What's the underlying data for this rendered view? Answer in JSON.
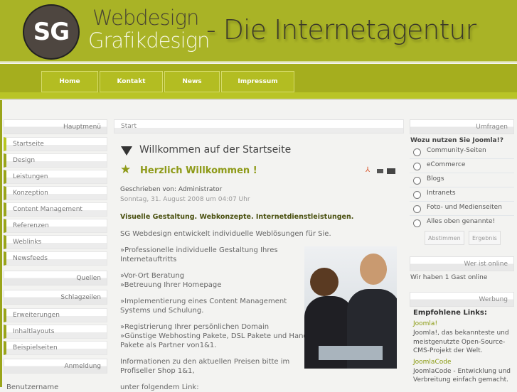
{
  "header": {
    "logo": "SG",
    "line1": "Webdesign",
    "line2": "Grafikdesign",
    "tagline": "- Die Internetagentur"
  },
  "nav": [
    "Home",
    "Kontakt",
    "News",
    "Impressum"
  ],
  "left": {
    "hauptmenu": "Hauptmenü",
    "items": [
      "Startseite",
      "Design",
      "Leistungen",
      "Konzeption",
      "Content Management",
      "Referenzen",
      "Weblinks",
      "Newsfeeds"
    ],
    "quellen": "Quellen",
    "schlagzeilen": "Schlagzeilen",
    "items2": [
      "Erweiterungen",
      "Inhaltlayouts",
      "Beispielseiten"
    ],
    "anmeldung": "Anmeldung",
    "username_label": "Benutzername"
  },
  "main": {
    "breadcrumb": "Start",
    "page_title": "Willkommen auf der Startseite",
    "article_title": "Herzlich Willkommen !",
    "author": "Geschrieben von: Administrator",
    "date": "Sonntag, 31. August 2008 um 04:07 Uhr",
    "lead": "Visuelle Gestaltung. Webkonzepte. Internetdienstleistungen.",
    "p1": "SG Webdesign entwickelt individuelle Weblösungen für Sie.",
    "p2a": "»Professionelle individuelle Gestaltung Ihres",
    "p2b": "Internetauftritts",
    "p3a": "»Vor-Ort Beratung",
    "p3b": "»Betreuung Ihrer Homepage",
    "p4a": "»Implementierung eines Content Management",
    "p4b": "Systems und Schulung.",
    "p5a": "»Registrierung Ihrer persönlichen Domain",
    "p5b": "»Günstige Webhosting Pakete, DSL Pakete und Handy",
    "p5c": "Pakete als Partner von1&1.",
    "p6a": "Informationen zu den aktuellen Preisen bitte im",
    "p6b": "Profiseller Shop 1&1,",
    "p7": "unter folgendem Link:"
  },
  "right": {
    "umfragen": "Umfragen",
    "question": "Wozu nutzen Sie Joomla!?",
    "options": [
      "Community-Seiten",
      "eCommerce",
      "Blogs",
      "Intranets",
      "Foto- und Medienseiten",
      "Alles oben genannte!"
    ],
    "vote": "Abstimmen",
    "results": "Ergebnis",
    "online_title": "Wer ist online",
    "online_text": "Wir haben 1 Gast online",
    "werbung": "Werbung",
    "links_title": "Empfohlene Links:",
    "link1": "Joomla!",
    "link1_desc1": "Joomla!, das bekannteste und",
    "link1_desc2": "meistgenutzte Open-Source-",
    "link1_desc3": "CMS-Projekt der Welt.",
    "link2": "JoomlaCode",
    "link2_desc1": "JoomlaCode - Entwicklung und",
    "link2_desc2": "Verbreitung einfach gemacht."
  }
}
